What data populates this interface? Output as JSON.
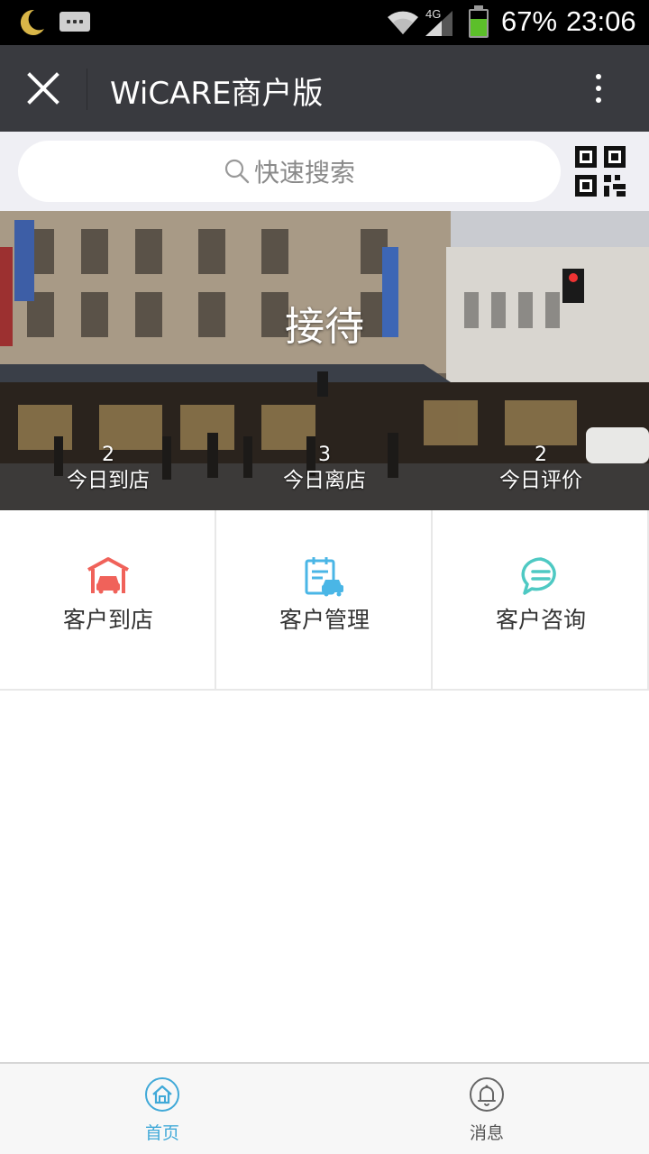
{
  "status_bar": {
    "battery_percent": "67%",
    "time": "23:06",
    "network": "4G",
    "icons": [
      "moon-icon",
      "message-icon",
      "wifi-icon",
      "signal-icon",
      "battery-icon"
    ]
  },
  "title_bar": {
    "title": "WiCARE商户版",
    "close_icon": "close-icon",
    "more_icon": "more-vertical-icon"
  },
  "search": {
    "placeholder": "快速搜索",
    "search_icon": "search-icon",
    "qr_icon": "qr-code-icon"
  },
  "banner": {
    "title": "接待",
    "stats": [
      {
        "value": "2",
        "label": "今日到店"
      },
      {
        "value": "3",
        "label": "今日离店"
      },
      {
        "value": "2",
        "label": "今日评价"
      }
    ]
  },
  "menu": {
    "items": [
      {
        "label": "客户到店",
        "icon": "garage-car-icon",
        "color": "#f0625a"
      },
      {
        "label": "客户管理",
        "icon": "clipboard-car-icon",
        "color": "#4ab6e6"
      },
      {
        "label": "客户咨询",
        "icon": "chat-bubble-icon",
        "color": "#4ec9c3"
      }
    ]
  },
  "tab_bar": {
    "tabs": [
      {
        "label": "首页",
        "icon": "home-icon",
        "active": true,
        "color": "#40a9d8"
      },
      {
        "label": "消息",
        "icon": "bell-icon",
        "active": false,
        "color": "#666666"
      }
    ]
  },
  "colors": {
    "title_bar_bg": "#393a3f",
    "search_area_bg": "#efeff4",
    "accent": "#40a9d8"
  }
}
